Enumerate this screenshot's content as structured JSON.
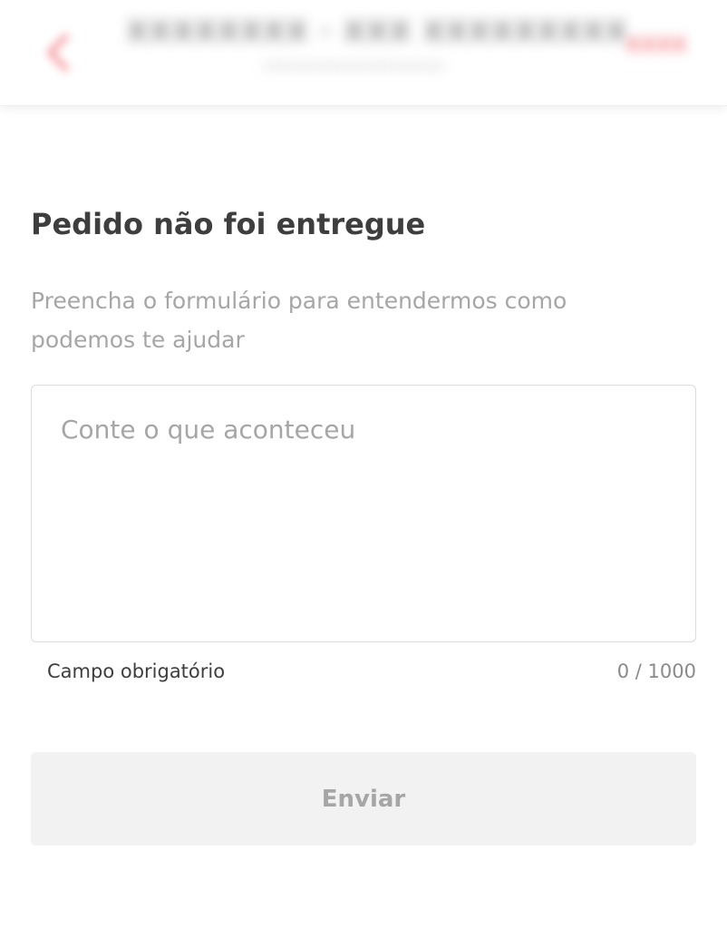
{
  "header": {
    "title_blurred": "XXXXXXXX · XXX XXXXXXXXX",
    "subtitle_blurred": "xxxxxxxxxxxxxxxxxxxxxxxx",
    "action_blurred": "XXXX"
  },
  "form": {
    "title": "Pedido não foi entregue",
    "subtitle": "Preencha o formulário para entendermos como podemos te ajudar",
    "textarea_placeholder": "Conte o que aconteceu",
    "textarea_value": "",
    "helper_text": "Campo obrigatório",
    "char_counter": "0 / 1000",
    "submit_label": "Enviar"
  },
  "colors": {
    "brand_red": "#ea1d2c",
    "text_dark": "#3e3e3e",
    "text_muted": "#a6a6a6",
    "disabled_bg": "#f2f2f2",
    "border": "#dcdcdc"
  },
  "icons": {
    "back": "back-arrow-icon"
  }
}
